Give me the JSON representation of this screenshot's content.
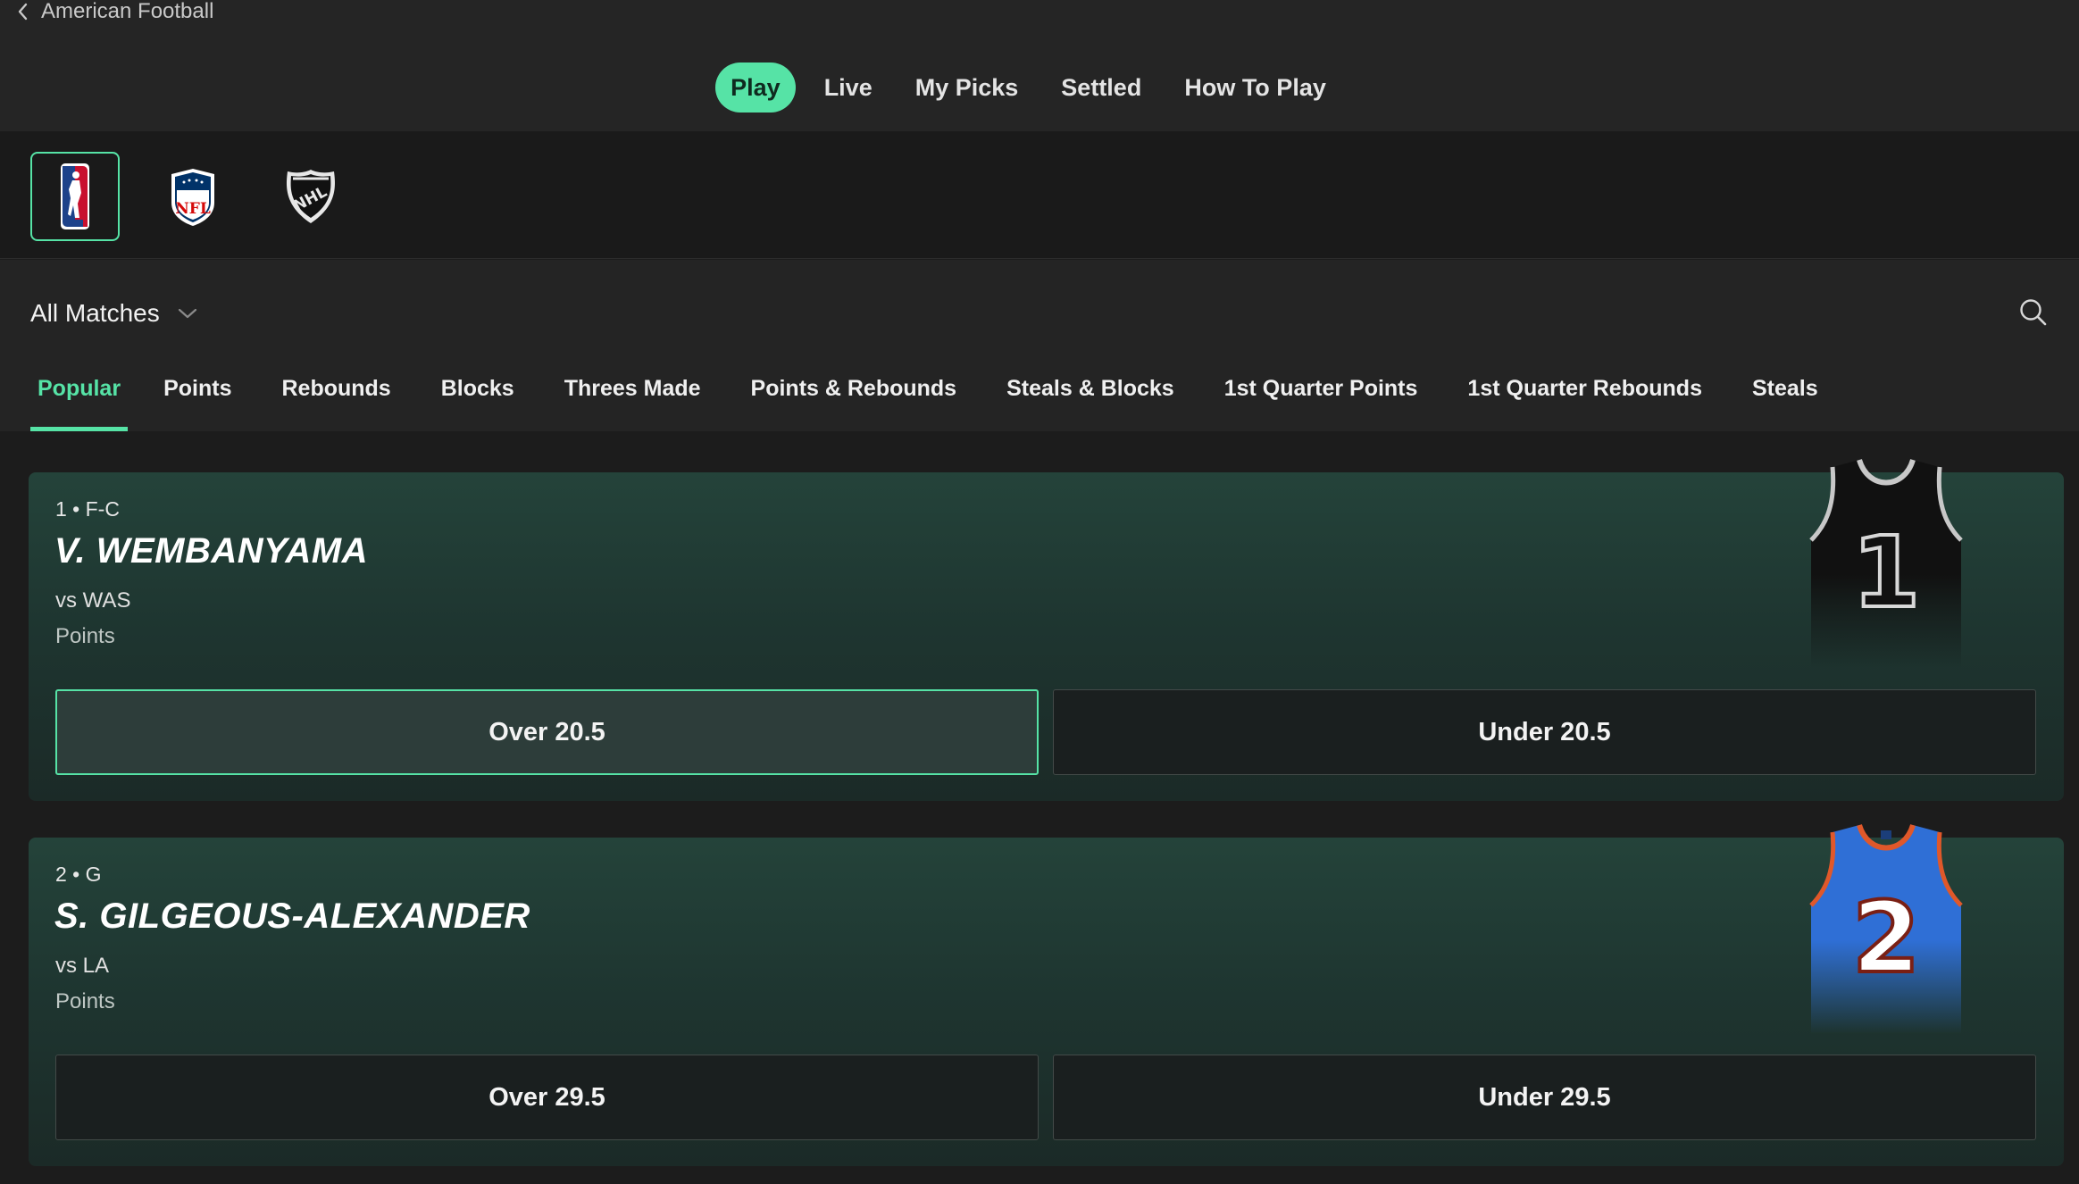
{
  "header": {
    "back_label": "American Football",
    "nav_tabs": [
      "Play",
      "Live",
      "My Picks",
      "Settled",
      "How To Play"
    ],
    "active_tab": "Play"
  },
  "leagues": [
    {
      "name": "NBA",
      "icon": "nba-logo-icon",
      "active": true
    },
    {
      "name": "NFL",
      "icon": "nfl-logo-icon",
      "active": false
    },
    {
      "name": "NHL",
      "icon": "nhl-logo-icon",
      "active": false
    }
  ],
  "filters": {
    "matches_label": "All Matches",
    "stat_tabs": [
      "Popular",
      "Points",
      "Rebounds",
      "Blocks",
      "Threes Made",
      "Points & Rebounds",
      "Steals & Blocks",
      "1st Quarter Points",
      "1st Quarter Rebounds",
      "Steals"
    ],
    "active_stat": "Popular"
  },
  "cards": [
    {
      "meta": "1 • F-C",
      "name": "V. WEMBANYAMA",
      "opponent": "vs WAS",
      "stat": "Points",
      "over_label": "Over 20.5",
      "under_label": "Under 20.5",
      "over_selected": true,
      "jersey_number": "1",
      "jersey_color": "#111111",
      "jersey_trim": "#c8c8c8"
    },
    {
      "meta": "2 • G",
      "name": "S. GILGEOUS-ALEXANDER",
      "opponent": "vs LA",
      "stat": "Points",
      "over_label": "Over 29.5",
      "under_label": "Under 29.5",
      "over_selected": false,
      "jersey_number": "2",
      "jersey_color": "#2f6fd6",
      "jersey_trim": "#e0582a"
    }
  ],
  "colors": {
    "accent": "#56e3a6",
    "background": "#1c1c1c"
  }
}
